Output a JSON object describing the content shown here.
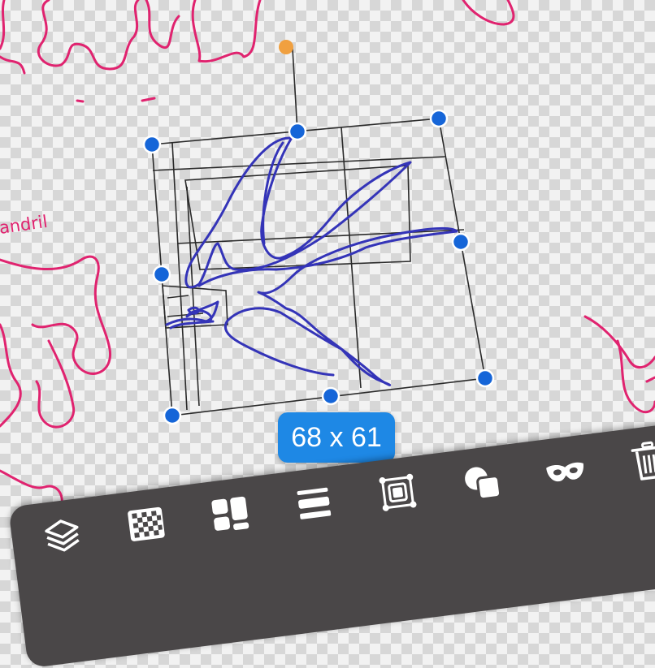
{
  "canvas": {
    "label_text": "andril",
    "size_label": "68 x 61"
  },
  "colors": {
    "stroke_pink": "#e0236f",
    "stroke_blue": "#3434b8",
    "handle_blue": "#1565d8",
    "rotate_handle": "#f0a040",
    "badge_blue": "#1e88e5",
    "toolbar_bg": "#4a4748",
    "icon_white": "#ffffff"
  },
  "toolbar": {
    "tools": [
      {
        "icon": "layers-icon"
      },
      {
        "icon": "checkerboard-icon"
      },
      {
        "icon": "arrange-grid-icon"
      },
      {
        "icon": "align-lines-icon"
      },
      {
        "icon": "fit-frame-icon"
      },
      {
        "icon": "duplicate-shapes-icon"
      },
      {
        "icon": "mask-icon"
      },
      {
        "icon": "trash-icon"
      }
    ]
  }
}
